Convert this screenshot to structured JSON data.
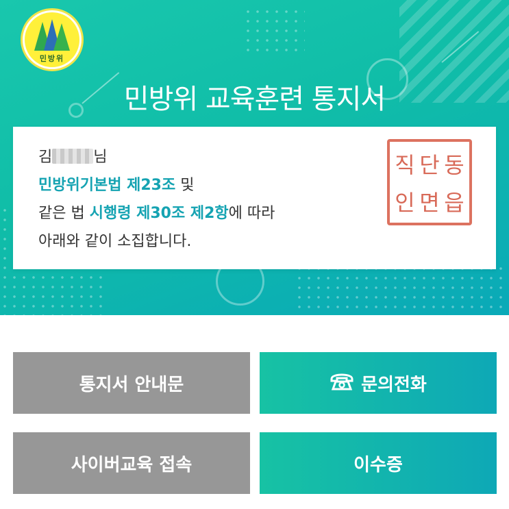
{
  "header": {
    "logo_text": "민방위",
    "title": "민방위 교육훈련 통지서"
  },
  "notice": {
    "recipient_suffix": "님",
    "recipient_prefix": "김",
    "line2_highlight": "민방위기본법 제23조",
    "line2_rest": " 및",
    "line3_pre": "같은 법 ",
    "line3_highlight": "시행령 제30조 제2항",
    "line3_post": "에 따라",
    "line4": "아래와 같이 소집합니다.",
    "seal_chars": [
      "동",
      "단",
      "읍",
      "인",
      "직",
      "면"
    ]
  },
  "buttons": {
    "guide": "통지서 안내문",
    "inquiry": "문의전화",
    "cyber": "사이버교육 접속",
    "certificate": "이수증"
  },
  "colors": {
    "teal": "#17c2a4",
    "highlight": "#15a3b2",
    "gray_button": "#979797",
    "seal_red": "#d45a46"
  },
  "icons": {
    "inquiry": "phone-icon"
  }
}
